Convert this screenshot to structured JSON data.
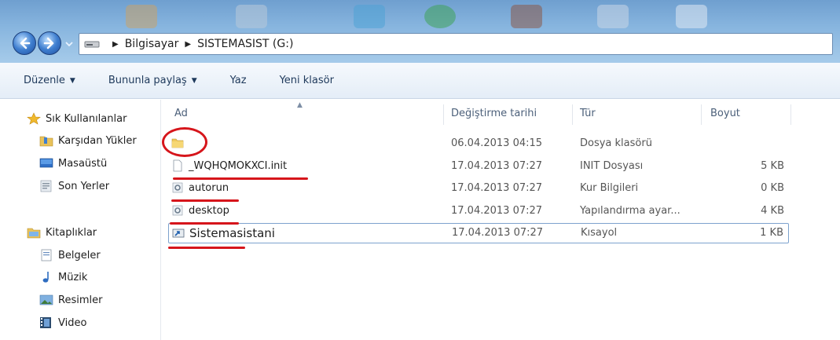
{
  "address": {
    "crumbs": [
      "Bilgisayar",
      "SISTEMASIST (G:)"
    ]
  },
  "toolbar": {
    "organize": "Düzenle",
    "share": "Bununla paylaş",
    "burn": "Yaz",
    "new_folder": "Yeni klasör"
  },
  "sidebar": {
    "favorites": "Sık Kullanılanlar",
    "downloads": "Karşıdan Yükler",
    "desktop": "Masaüstü",
    "recent": "Son Yerler",
    "libraries": "Kitaplıklar",
    "documents": "Belgeler",
    "music": "Müzik",
    "pictures": "Resimler",
    "videos": "Video"
  },
  "columns": {
    "name": "Ad",
    "modified": "Değiştirme tarihi",
    "type": "Tür",
    "size": "Boyut"
  },
  "files": [
    {
      "name": "",
      "date": "06.04.2013 04:15",
      "type": "Dosya klasörü",
      "size": "",
      "icon": "folder-icon"
    },
    {
      "name": "_WQHQMOKXCI.init",
      "date": "17.04.2013 07:27",
      "type": "INIT Dosyası",
      "size": "5 KB",
      "icon": "file-icon"
    },
    {
      "name": "autorun",
      "date": "17.04.2013 07:27",
      "type": "Kur Bilgileri",
      "size": "0 KB",
      "icon": "settings-file-icon"
    },
    {
      "name": "desktop",
      "date": "17.04.2013 07:27",
      "type": "Yapılandırma ayar...",
      "size": "4 KB",
      "icon": "settings-file-icon"
    },
    {
      "name": "Sistemasistani",
      "date": "17.04.2013 07:27",
      "type": "Kısayol",
      "size": "1 KB",
      "icon": "shortcut-icon"
    }
  ],
  "colors": {
    "annotation_red": "#d6151b",
    "selection_border": "#7da2ce"
  }
}
